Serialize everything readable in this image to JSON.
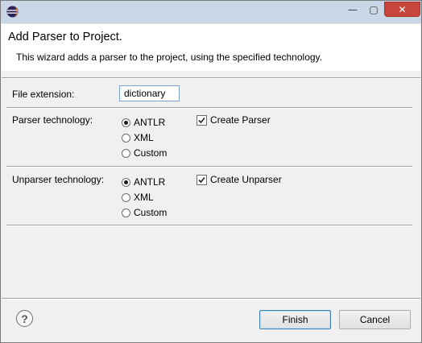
{
  "window": {
    "title": "",
    "min_symbol": "—",
    "max_symbol": "▢",
    "close_symbol": "✕"
  },
  "header": {
    "title": "Add Parser to Project.",
    "description": "This wizard adds a parser to the project, using the specified technology."
  },
  "form": {
    "file_extension": {
      "label": "File extension:",
      "value": "dictionary"
    },
    "parser": {
      "label": "Parser technology:",
      "options": [
        "ANTLR",
        "XML",
        "Custom"
      ],
      "selected": "ANTLR",
      "create_label": "Create Parser",
      "create_checked": true
    },
    "unparser": {
      "label": "Unparser technology:",
      "options": [
        "ANTLR",
        "XML",
        "Custom"
      ],
      "selected": "ANTLR",
      "create_label": "Create Unparser",
      "create_checked": true
    }
  },
  "footer": {
    "help_symbol": "?",
    "finish_label": "Finish",
    "cancel_label": "Cancel"
  },
  "icons": {
    "app": "eclipse-icon",
    "help": "help-icon"
  }
}
